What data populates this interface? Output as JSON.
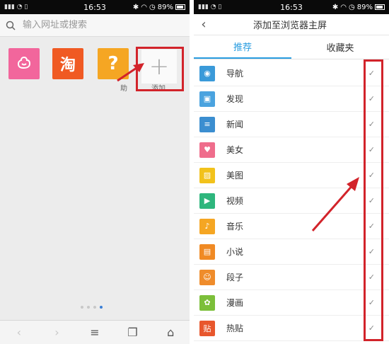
{
  "status": {
    "time": "16:53",
    "battery": "89%"
  },
  "left": {
    "search_placeholder": "输入网址或搜索",
    "tiles": [
      {
        "name": "flower",
        "glyph": "✿",
        "color": "#f2669c"
      },
      {
        "name": "taobao",
        "glyph": "淘",
        "color": "#f05a23"
      },
      {
        "name": "help",
        "glyph": "?",
        "label": "助",
        "color": "#f5a623"
      }
    ],
    "add_label": "添加",
    "add_glyph": "+"
  },
  "right": {
    "title": "添加至浏览器主屏",
    "tabs": [
      "推荐",
      "收藏夹"
    ],
    "items": [
      {
        "label": "导航",
        "color": "#3a9ad9",
        "glyph": "◉"
      },
      {
        "label": "发现",
        "color": "#4aa3df",
        "glyph": "▣"
      },
      {
        "label": "新闻",
        "color": "#3b8ed0",
        "glyph": "≡"
      },
      {
        "label": "美女",
        "color": "#ef6d8c",
        "glyph": "♥"
      },
      {
        "label": "美图",
        "color": "#f2c21b",
        "glyph": "▨"
      },
      {
        "label": "视频",
        "color": "#2eb67d",
        "glyph": "▶"
      },
      {
        "label": "音乐",
        "color": "#f5a623",
        "glyph": "♪"
      },
      {
        "label": "小说",
        "color": "#f08a24",
        "glyph": "▤"
      },
      {
        "label": "段子",
        "color": "#ef8c2b",
        "glyph": "☺"
      },
      {
        "label": "漫画",
        "color": "#7cbf3a",
        "glyph": "✿"
      },
      {
        "label": "热贴",
        "color": "#e8572d",
        "glyph": "贴"
      }
    ],
    "check_glyph": "✓"
  },
  "colors": {
    "accent": "#2a9de0",
    "annotation": "#d2232a"
  }
}
